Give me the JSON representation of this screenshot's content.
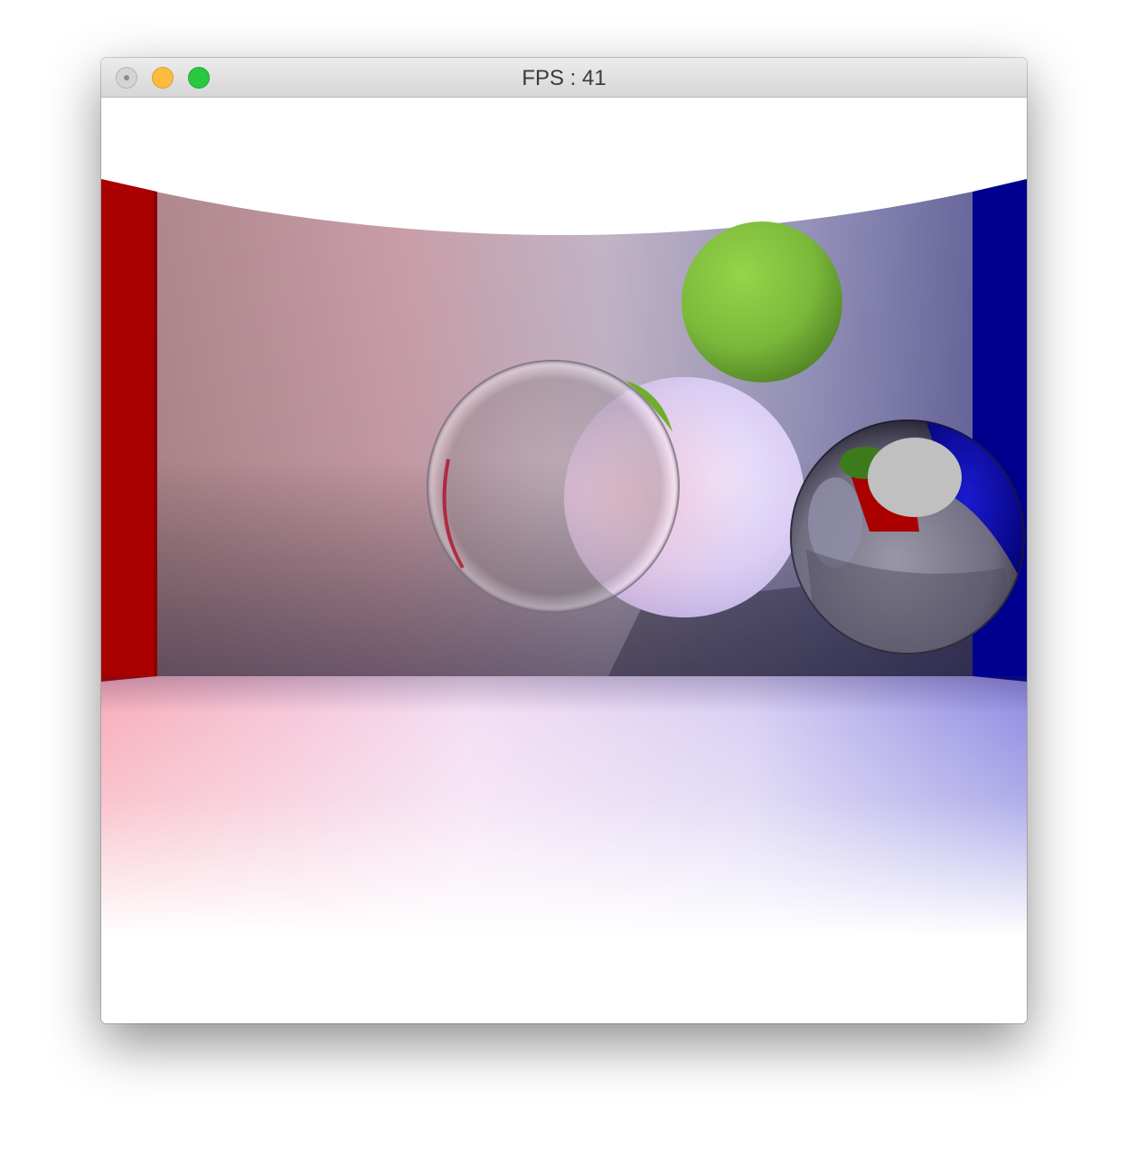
{
  "window": {
    "title": "FPS : 41"
  },
  "titlebar_buttons": {
    "close": "close-icon",
    "minimize": "minimize-icon",
    "maximize": "maximize-icon"
  },
  "scene": {
    "left_wall_color": "#aa0000",
    "right_wall_color": "#00008f",
    "floor_color": "#ffffff",
    "ceiling_color": "#ffffff",
    "objects": [
      "green-sphere",
      "glass-sphere",
      "white-sphere",
      "mirror-sphere"
    ]
  }
}
